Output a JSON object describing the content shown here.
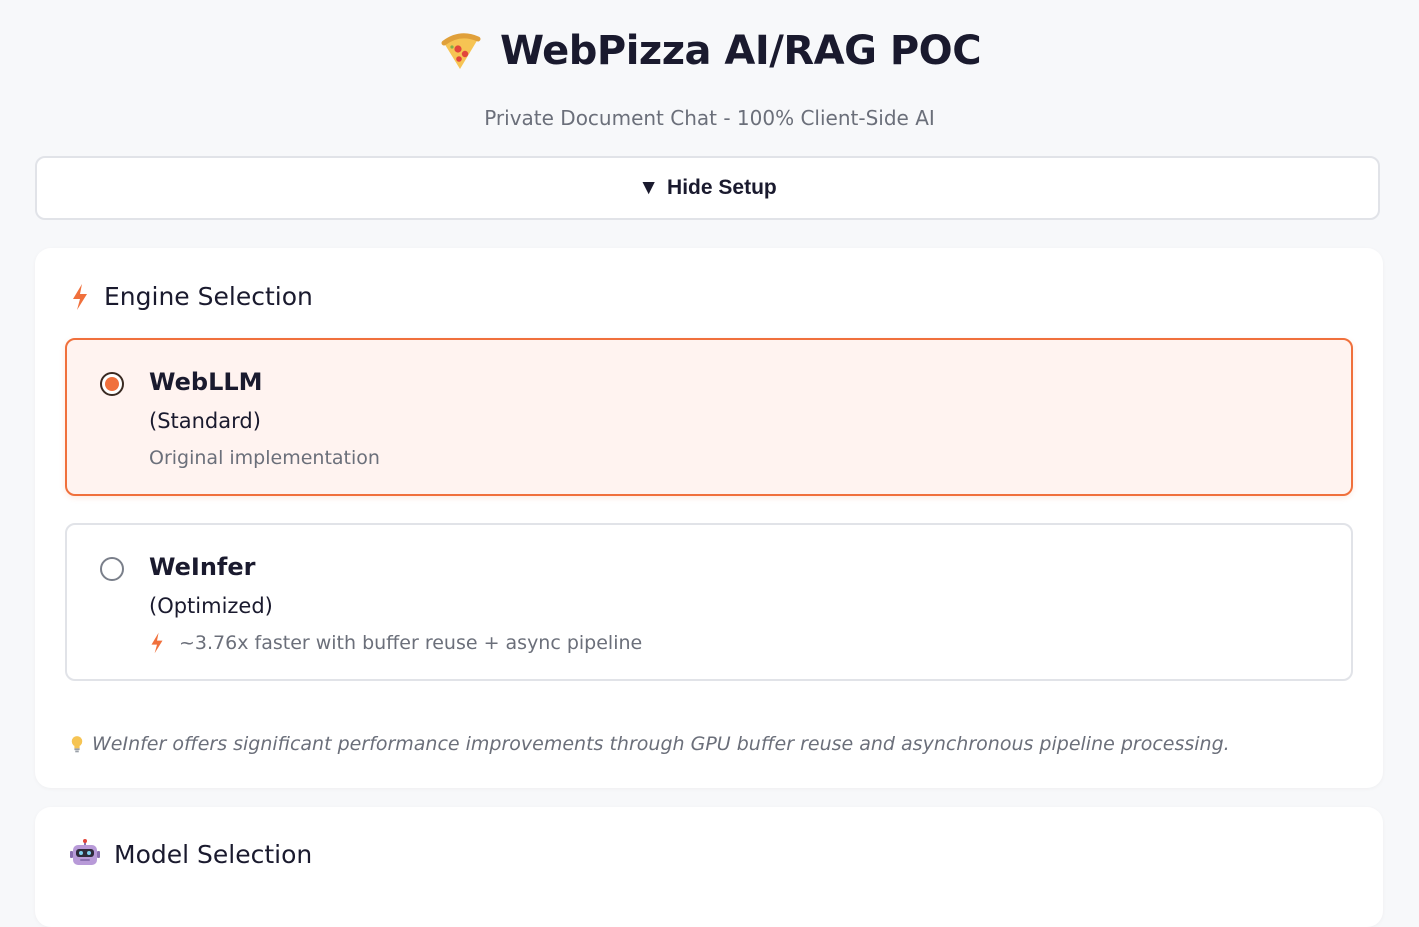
{
  "header": {
    "title": "WebPizza AI/RAG POC",
    "subtitle": "Private Document Chat - 100% Client-Side AI",
    "logo_icon": "pizza-icon"
  },
  "setup_toggle": {
    "arrow": "▼",
    "label": "Hide Setup"
  },
  "engine_section": {
    "icon": "lightning-icon",
    "title": "Engine Selection",
    "options": [
      {
        "name": "WebLLM",
        "variant": "(Standard)",
        "description": "Original implementation",
        "selected": true
      },
      {
        "name": "WeInfer",
        "variant": "(Optimized)",
        "description_icon": "lightning-icon",
        "description": "~3.76x faster with buffer reuse + async pipeline",
        "selected": false
      }
    ],
    "tip_icon": "lightbulb-icon",
    "tip": "WeInfer offers significant performance improvements through GPU buffer reuse and asynchronous pipeline processing."
  },
  "model_section": {
    "icon": "robot-icon",
    "title": "Model Selection"
  },
  "colors": {
    "accent": "#f0703c",
    "selected_bg": "#fff3f0",
    "text": "#1a1a2e",
    "muted": "#6b6f7a",
    "page_bg": "#f7f8fa"
  }
}
